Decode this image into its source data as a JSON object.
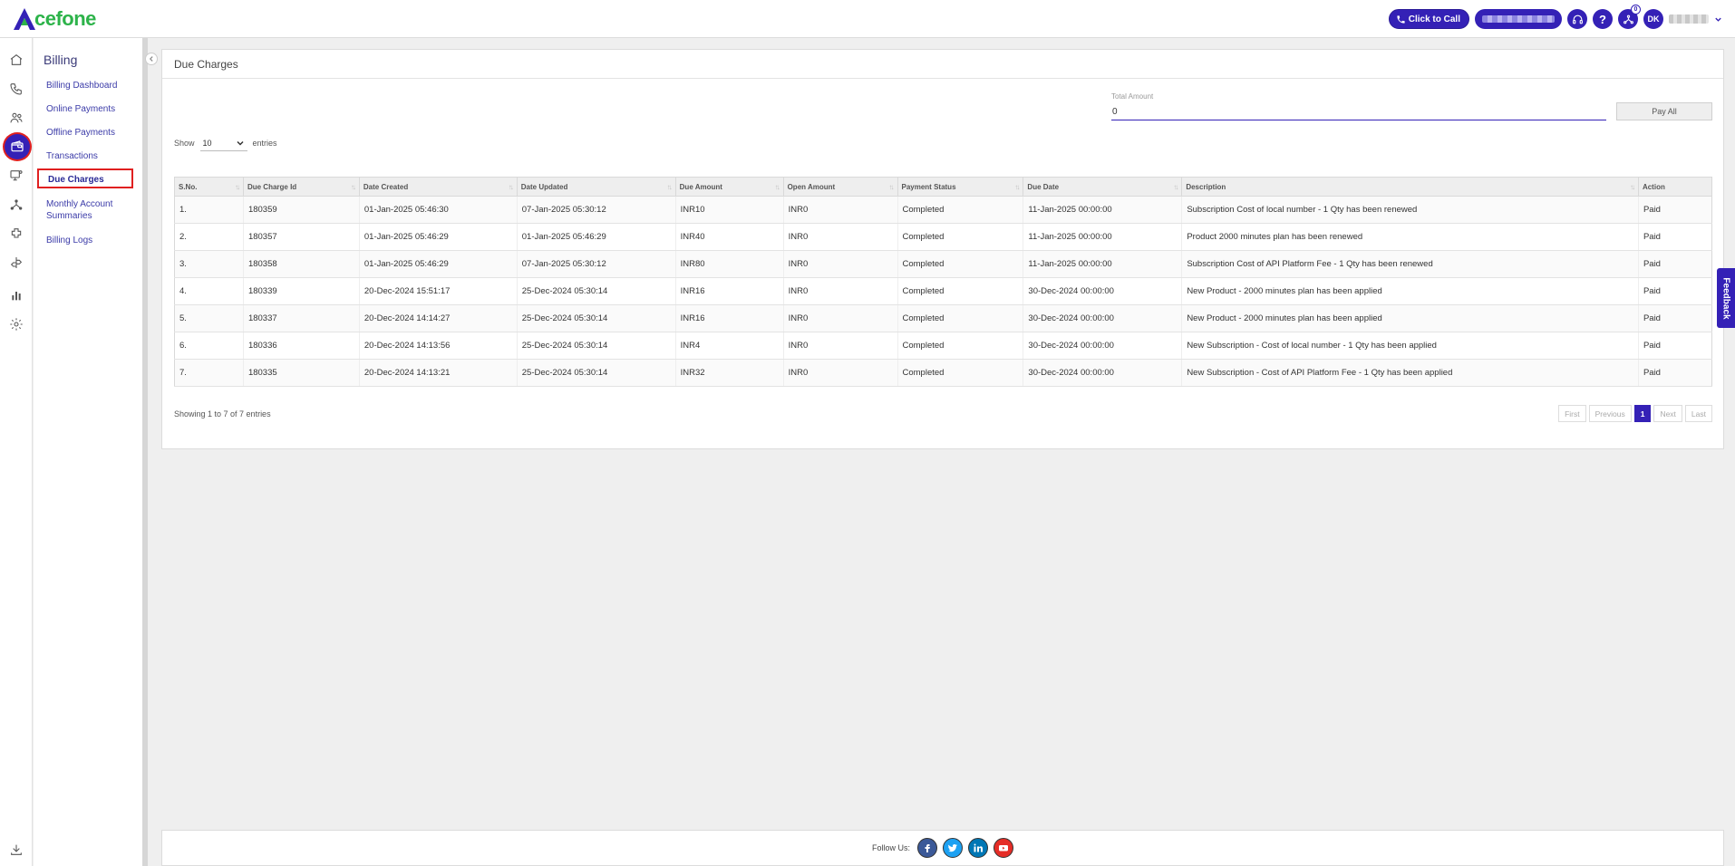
{
  "brand": {
    "logo_text": "cefone",
    "logo_color": "#2db34a",
    "accent": "#3421b6"
  },
  "header": {
    "click_to_call": "Click to Call",
    "help": "?",
    "notification_count": "0",
    "avatar_initials": "DK"
  },
  "rail_icons": [
    "home-icon",
    "phone-icon",
    "users-icon",
    "wallet-icon",
    "monitor-icon",
    "network-icon",
    "puzzle-icon",
    "route-icon",
    "bar-chart-icon",
    "gear-icon"
  ],
  "sidebar": {
    "title": "Billing",
    "items": [
      {
        "label": "Billing Dashboard"
      },
      {
        "label": "Online Payments"
      },
      {
        "label": "Offline Payments"
      },
      {
        "label": "Transactions"
      },
      {
        "label": "Due Charges"
      },
      {
        "label": "Monthly Account Summaries"
      },
      {
        "label": "Billing Logs"
      }
    ]
  },
  "card": {
    "title": "Due Charges",
    "total_amount_label": "Total Amount",
    "total_amount_value": "0",
    "pay_all": "Pay All",
    "show_label": "Show",
    "entries_value": "10",
    "entries_label": "entries"
  },
  "table": {
    "columns": [
      "S.No.",
      "Due Charge Id",
      "Date Created",
      "Date Updated",
      "Due Amount",
      "Open Amount",
      "Payment Status",
      "Due Date",
      "Description",
      "Action"
    ],
    "rows": [
      [
        "1.",
        "180359",
        "01-Jan-2025 05:46:30",
        "07-Jan-2025 05:30:12",
        "INR10",
        "INR0",
        "Completed",
        "11-Jan-2025 00:00:00",
        "Subscription Cost of local number - 1 Qty has been renewed",
        "Paid"
      ],
      [
        "2.",
        "180357",
        "01-Jan-2025 05:46:29",
        "01-Jan-2025 05:46:29",
        "INR40",
        "INR0",
        "Completed",
        "11-Jan-2025 00:00:00",
        "Product 2000 minutes plan has been renewed",
        "Paid"
      ],
      [
        "3.",
        "180358",
        "01-Jan-2025 05:46:29",
        "07-Jan-2025 05:30:12",
        "INR80",
        "INR0",
        "Completed",
        "11-Jan-2025 00:00:00",
        "Subscription Cost of API Platform Fee - 1 Qty has been renewed",
        "Paid"
      ],
      [
        "4.",
        "180339",
        "20-Dec-2024 15:51:17",
        "25-Dec-2024 05:30:14",
        "INR16",
        "INR0",
        "Completed",
        "30-Dec-2024 00:00:00",
        "New Product - 2000 minutes plan has been applied",
        "Paid"
      ],
      [
        "5.",
        "180337",
        "20-Dec-2024 14:14:27",
        "25-Dec-2024 05:30:14",
        "INR16",
        "INR0",
        "Completed",
        "30-Dec-2024 00:00:00",
        "New Product - 2000 minutes plan has been applied",
        "Paid"
      ],
      [
        "6.",
        "180336",
        "20-Dec-2024 14:13:56",
        "25-Dec-2024 05:30:14",
        "INR4",
        "INR0",
        "Completed",
        "30-Dec-2024 00:00:00",
        "New Subscription - Cost of local number - 1 Qty has been applied",
        "Paid"
      ],
      [
        "7.",
        "180335",
        "20-Dec-2024 14:13:21",
        "25-Dec-2024 05:30:14",
        "INR32",
        "INR0",
        "Completed",
        "30-Dec-2024 00:00:00",
        "New Subscription - Cost of API Platform Fee - 1 Qty has been applied",
        "Paid"
      ]
    ]
  },
  "footer_info": {
    "showing": "Showing 1 to 7 of 7 entries",
    "pager": {
      "first": "First",
      "previous": "Previous",
      "current": "1",
      "next": "Next",
      "last": "Last"
    }
  },
  "feedback": "Feedback",
  "footer": {
    "follow_us": "Follow Us:",
    "social": [
      {
        "name": "facebook-icon",
        "color": "#3b5998"
      },
      {
        "name": "twitter-icon",
        "color": "#1da1f2"
      },
      {
        "name": "linkedin-icon",
        "color": "#0077b5"
      },
      {
        "name": "youtube-icon",
        "color": "#e52d27"
      }
    ]
  }
}
